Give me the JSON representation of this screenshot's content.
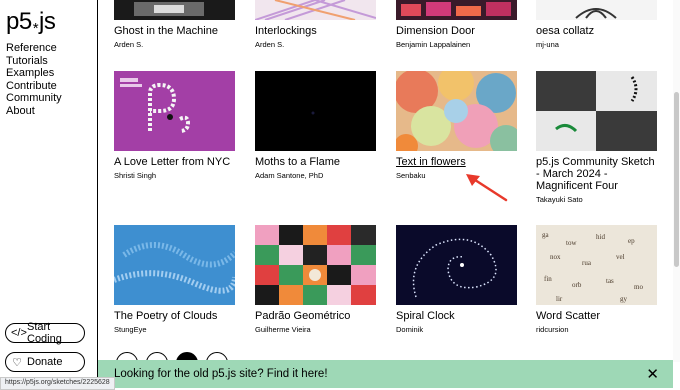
{
  "sidebar": {
    "logo": {
      "p5": "p5",
      "star": "*",
      "js": "js"
    },
    "nav": [
      {
        "label": "Reference"
      },
      {
        "label": "Tutorials"
      },
      {
        "label": "Examples"
      },
      {
        "label": "Contribute"
      },
      {
        "label": "Community"
      },
      {
        "label": "About"
      }
    ],
    "start_coding": "Start Coding",
    "donate": "Donate"
  },
  "sketches": [
    {
      "title": "Ghost in the Machine",
      "author": "Arden S."
    },
    {
      "title": "Interlockings",
      "author": "Arden S."
    },
    {
      "title": "Dimension Door",
      "author": "Benjamin Lappalainen"
    },
    {
      "title": "oesa collatz",
      "author": "mj-una"
    },
    {
      "title": "A Love Letter from NYC",
      "author": "Shristi Singh"
    },
    {
      "title": "Moths to a Flame",
      "author": "Adam Santone, PhD"
    },
    {
      "title": "Text in flowers",
      "author": "Senbaku"
    },
    {
      "title": "p5.js Community Sketch - March 2024 - Magnificent Four",
      "author": "Takayuki Sato"
    },
    {
      "title": "The Poetry of Clouds",
      "author": "StungEye"
    },
    {
      "title": "Padrão Geométrico",
      "author": "Guilherme Vieira"
    },
    {
      "title": "Spiral Clock",
      "author": "Dominik"
    },
    {
      "title": "Word Scatter",
      "author": "ridcursion"
    }
  ],
  "banner": {
    "text": "Looking for the old p5.js site? Find it here!",
    "close": "✕"
  },
  "status_url": "https://p5js.org/sketches/2225628",
  "colors": {
    "banner": "#9ed8b6",
    "annotation_arrow": "#e8392b"
  }
}
